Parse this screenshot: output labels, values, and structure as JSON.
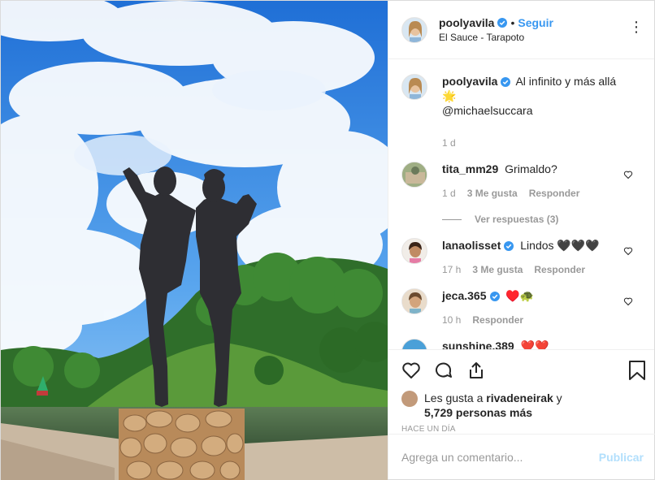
{
  "post": {
    "username": "poolyavila",
    "separator": "•",
    "follow_label": "Seguir",
    "location": "El Sauce - Tarapoto",
    "more_label": "•••"
  },
  "caption": {
    "username": "poolyavila",
    "text": "Al infinito y más allá 🌟",
    "mention": "@michaelsuccara",
    "time": "1 d"
  },
  "comments": [
    {
      "username": "tita_mm29",
      "text": "Grimaldo?",
      "time": "1 d",
      "likes": "3 Me gusta",
      "reply": "Responder",
      "view_replies": "Ver respuestas (3)"
    },
    {
      "username": "lanaolisset",
      "text": "Lindos 🖤🖤🖤",
      "time": "17 h",
      "likes": "3 Me gusta",
      "reply": "Responder"
    },
    {
      "username": "jeca.365",
      "text": "♥️🐢",
      "time": "10 h",
      "reply": "Responder"
    },
    {
      "username": "sunshine.389",
      "text": "❤️❤️"
    }
  ],
  "likes": {
    "prefix": "Les gusta a",
    "user": "rivadeneirak",
    "conj": "y",
    "count": "5,729 personas más"
  },
  "time_ago": "HACE UN DÍA",
  "add_comment": {
    "placeholder": "Agrega un comentario...",
    "publish": "Publicar"
  },
  "colors": {
    "accent": "#3897f0",
    "publish_disabled": "#b2dffc",
    "muted": "#999999",
    "verified": "#3897f0"
  },
  "icons": [
    "heart-icon",
    "comment-icon",
    "share-icon",
    "bookmark-icon",
    "verified-icon",
    "more-icon"
  ]
}
